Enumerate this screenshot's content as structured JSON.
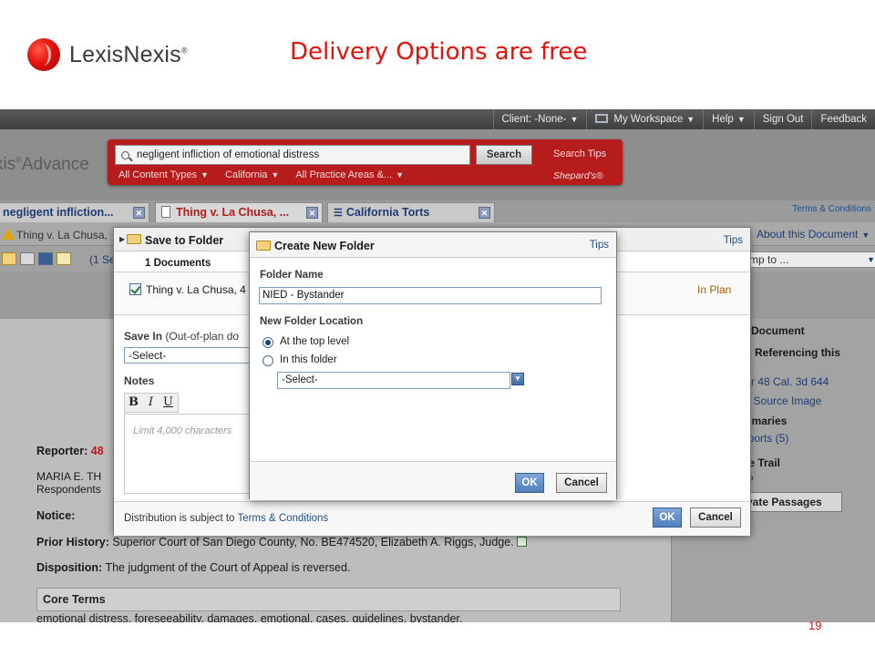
{
  "slide": {
    "logo_text": "LexisNexis",
    "logo_mark": "®",
    "title": "Delivery Options are free",
    "page_number": "19"
  },
  "topbar": {
    "items": [
      "Client: -None-",
      "My Workspace",
      "Help",
      "Sign Out",
      "Feedback"
    ]
  },
  "brand": {
    "product": "xis",
    "mark": "®",
    "suffix": "Advance"
  },
  "search": {
    "query": "negligent infliction of emotional distress",
    "button_label": "Search",
    "tips_label": "Search Tips",
    "shepards_label": "Shepard's®",
    "filters": [
      "All Content Types",
      "California",
      "All Practice Areas &..."
    ]
  },
  "terms_link": "Terms & Conditions",
  "tabs": [
    {
      "label": "negligent infliction..."
    },
    {
      "label": "Thing v. La Chusa, ..."
    },
    {
      "label": "California Torts"
    }
  ],
  "docbar": {
    "warning_text": "Thing v. La Chusa,",
    "about_label": "About this Document",
    "jump_placeholder": "mp to ...",
    "tool_count": "(1 Se"
  },
  "document": {
    "reporter_label": "Reporter:",
    "reporter_value": "48",
    "parties_line1": "MARIA E. TH",
    "parties_line2": "Respondents",
    "notice_label": "Notice:",
    "prior_history_label": "Prior History:",
    "prior_history_value": "Superior Court of San Diego County, No. BE474520, Elizabeth A. Riggs, Judge.",
    "disposition_label": "Disposition:",
    "disposition_value": "The judgment of the Court of Appeal is reversed.",
    "core_terms_label": "Core Terms",
    "core_terms_value": "emotional distress, foreseeability, damages, emotional, cases, guidelines, bystander,"
  },
  "right_pane": {
    "heading1": "s Document",
    "heading2": "ts Referencing this",
    "link1": "for 48 Cal. 3d 644",
    "link2": "al Source Image",
    "heading3": "mmaries",
    "link3": "eports (5)",
    "heading4": "ue Trail",
    "link4": "s?",
    "button_label": "vate Passages"
  },
  "save_dialog": {
    "title": "Save to Folder",
    "tips_label": "Tips",
    "documents_count": "1 Documents",
    "doc_title": "Thing v. La Chusa, 4",
    "in_plan": "In Plan",
    "save_in_label": "Save In",
    "save_in_note": "(Out-of-plan do",
    "select_value": "-Select-",
    "notes_label": "Notes",
    "notes_placeholder": "Limit 4,000 characters",
    "rte_buttons": [
      "B",
      "I",
      "U"
    ],
    "distribution_text": "Distribution is subject to",
    "distribution_link": "Terms & Conditions",
    "ok_label": "OK",
    "cancel_label": "Cancel"
  },
  "create_folder_dialog": {
    "title": "Create New Folder",
    "tips_label": "Tips",
    "folder_name_label": "Folder Name",
    "folder_name_value": "NIED - Bystander",
    "location_label": "New Folder Location",
    "option_top": "At the top level",
    "option_folder": "In this folder",
    "selected_option": "At the top level",
    "folder_select_value": "-Select-",
    "ok_label": "OK",
    "cancel_label": "Cancel"
  },
  "colors": {
    "brand_red": "#e3120b",
    "search_panel": "#b71c1c",
    "link_blue": "#1f4e8c",
    "ok_button": "#4f7fbc"
  }
}
